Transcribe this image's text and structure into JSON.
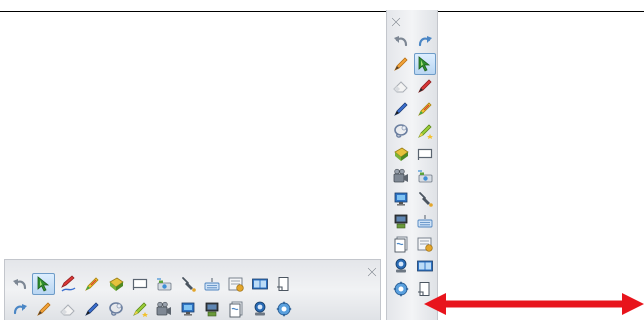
{
  "colors": {
    "toolbar_bg": "#eceef1",
    "active_tool_bg": "#cfe3f8",
    "annotation_arrow": "#e8141c"
  },
  "vertical_toolbar": {
    "close_icon": "close-icon",
    "tools": [
      "undo-icon",
      "redo-icon",
      "pen-icon",
      "select-arrow-icon",
      "eraser-icon",
      "highlighter-red-icon",
      "pen-blue-icon",
      "pen-multicolor-icon",
      "lasso-icon",
      "magic-pen-icon",
      "fill-icon",
      "shapes-icon",
      "screen-recorder-icon",
      "screen-capture-icon",
      "display-icon",
      "pointer-icon",
      "document-camera-icon",
      "keyboard-icon",
      "pages-icon",
      "page-sorter-icon",
      "conference-icon",
      "dual-display-icon",
      "settings-icon",
      "toolbar-swap-icon"
    ],
    "active_tool": "select-arrow-icon"
  },
  "horizontal_toolbar": {
    "close_icon": "close-icon",
    "row1": [
      "undo-icon",
      "select-arrow-icon",
      "pen-red-icon",
      "pen-multicolor-icon",
      "fill-icon",
      "shapes-icon",
      "screen-capture-icon",
      "pointer-icon",
      "keyboard-icon",
      "page-sorter-icon",
      "dual-display-icon",
      "toolbar-swap-icon"
    ],
    "row2": [
      "redo-icon",
      "pen-icon",
      "eraser-icon",
      "pen-blue-icon",
      "lasso-icon",
      "magic-pen-icon",
      "screen-recorder-icon",
      "display-icon",
      "document-camera-icon",
      "pages-icon",
      "conference-icon",
      "settings-icon"
    ],
    "active_tool": "select-arrow-icon"
  },
  "annotation": {
    "icon": "double-headed-arrow-icon"
  }
}
